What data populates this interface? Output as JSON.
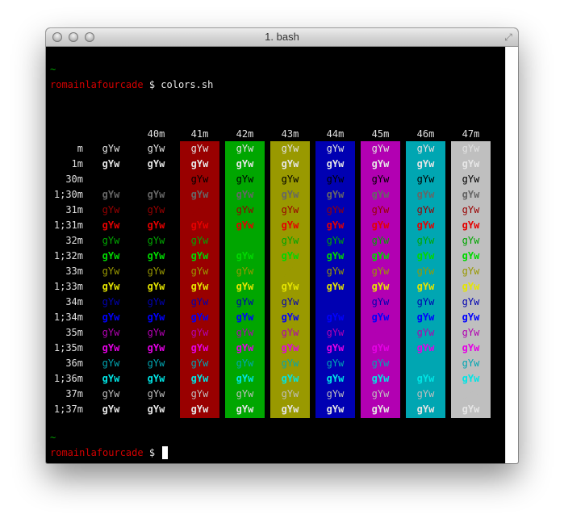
{
  "window": {
    "title": "1. bash",
    "controls": [
      "close-icon",
      "minimize-icon",
      "zoom-icon"
    ],
    "resize_icon": "fullscreen-icon"
  },
  "terminal": {
    "tilde": "~",
    "user": "romainlafourcade",
    "prompt": "$ ",
    "command": "colors.sh",
    "sample_text": "gYw",
    "bg_codes": [
      "",
      "",
      "40m",
      "41m",
      "42m",
      "43m",
      "44m",
      "45m",
      "46m",
      "47m"
    ],
    "fg_codes": [
      "m",
      "1m",
      "30m",
      "1;30m",
      "31m",
      "1;31m",
      "32m",
      "1;32m",
      "33m",
      "1;33m",
      "34m",
      "1;34m",
      "35m",
      "1;35m",
      "36m",
      "1;36m",
      "37m",
      "1;37m"
    ],
    "bg_colors": {
      "40m": "#000000",
      "41m": "#990000",
      "42m": "#00a600",
      "43m": "#999900",
      "44m": "#0000b2",
      "45m": "#b200b2",
      "46m": "#00a6b2",
      "47m": "#bfbfbf"
    },
    "fg_colors": {
      "m": "#e0e0e0",
      "1m": "#e6e6e6",
      "30m": "#000000",
      "1;30m": "#666666",
      "31m": "#990000",
      "1;31m": "#e50000",
      "32m": "#00a600",
      "1;32m": "#00d900",
      "33m": "#999900",
      "1;33m": "#e5e500",
      "34m": "#0000b2",
      "1;34m": "#0000ff",
      "35m": "#b200b2",
      "1;35m": "#e500e5",
      "36m": "#00a6b2",
      "1;36m": "#00e5e5",
      "37m": "#bfbfbf",
      "1;37m": "#e5e5e5"
    }
  }
}
